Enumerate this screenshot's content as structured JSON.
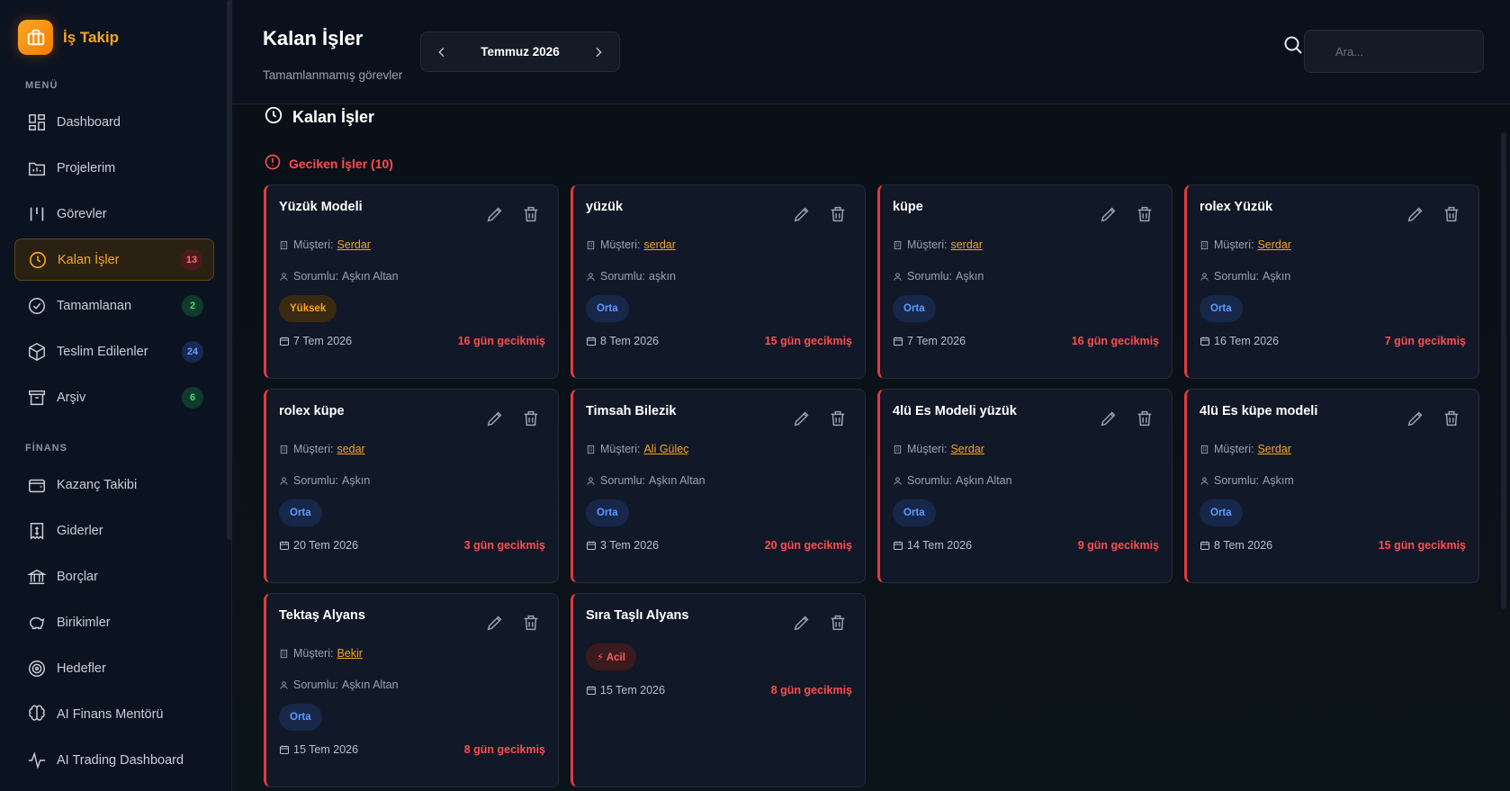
{
  "app": {
    "title": "İş Takip"
  },
  "sidebar": {
    "menu_label": "MENÜ",
    "finance_label": "FİNANS",
    "menu_items": [
      {
        "label": "Dashboard",
        "icon": "grid-icon",
        "badge": ""
      },
      {
        "label": "Projelerim",
        "icon": "folder-icon",
        "badge": ""
      },
      {
        "label": "Görevler",
        "icon": "columns-icon",
        "badge": ""
      },
      {
        "label": "Kalan İşler",
        "icon": "clock-icon",
        "badge": "13",
        "active": true
      },
      {
        "label": "Tamamlanan",
        "icon": "check-circle-icon",
        "badge": "2"
      },
      {
        "label": "Teslim Edilenler",
        "icon": "package-icon",
        "badge": "24"
      },
      {
        "label": "Arşiv",
        "icon": "archive-icon",
        "badge": "6"
      }
    ],
    "finance_items": [
      {
        "label": "Kazanç Takibi",
        "icon": "wallet-icon"
      },
      {
        "label": "Giderler",
        "icon": "receipt-icon"
      },
      {
        "label": "Borçlar",
        "icon": "bank-icon"
      },
      {
        "label": "Birikimler",
        "icon": "piggy-bank-icon"
      },
      {
        "label": "Hedefler",
        "icon": "target-icon"
      },
      {
        "label": "AI Finans Mentörü",
        "icon": "brain-icon"
      },
      {
        "label": "AI Trading Dashboard",
        "icon": "activity-icon"
      }
    ]
  },
  "header": {
    "title": "Kalan İşler",
    "subtitle": "Tamamlanmamış görevler",
    "month": "Temmuz 2026",
    "search_placeholder": "Ara..."
  },
  "main": {
    "section_title": "Kalan İşler",
    "overdue_title": "Geciken İşler (10)",
    "labels": {
      "customer": "Müşteri:",
      "owner": "Sorumlu:"
    },
    "cards": [
      {
        "title": "Yüzük Modeli",
        "customer": "Serdar",
        "owner": "Aşkın Altan",
        "priority": "Yüksek",
        "priority_type": "high",
        "date": "7 Tem 2026",
        "late": "16 gün gecikmiş"
      },
      {
        "title": "yüzük",
        "customer": "serdar",
        "owner": "aşkın",
        "priority": "Orta",
        "priority_type": "mid",
        "date": "8 Tem 2026",
        "late": "15 gün gecikmiş"
      },
      {
        "title": "küpe",
        "customer": "serdar",
        "owner": "Aşkın",
        "priority": "Orta",
        "priority_type": "mid",
        "date": "7 Tem 2026",
        "late": "16 gün gecikmiş"
      },
      {
        "title": "rolex Yüzük",
        "customer": "Serdar",
        "owner": "Aşkın",
        "priority": "Orta",
        "priority_type": "mid",
        "date": "16 Tem 2026",
        "late": "7 gün gecikmiş"
      },
      {
        "title": "rolex küpe",
        "customer": "sedar",
        "owner": "Aşkın",
        "priority": "Orta",
        "priority_type": "mid",
        "date": "20 Tem 2026",
        "late": "3 gün gecikmiş"
      },
      {
        "title": "Timsah Bilezik",
        "customer": "Ali Güleç",
        "owner": "Aşkın Altan",
        "priority": "Orta",
        "priority_type": "mid",
        "date": "3 Tem 2026",
        "late": "20 gün gecikmiş"
      },
      {
        "title": "4lü Es Modeli yüzük",
        "customer": "Serdar",
        "owner": "Aşkın Altan",
        "priority": "Orta",
        "priority_type": "mid",
        "date": "14 Tem 2026",
        "late": "9 gün gecikmiş"
      },
      {
        "title": "4lü Es küpe modeli",
        "customer": "Serdar",
        "owner": "Aşkım",
        "priority": "Orta",
        "priority_type": "mid",
        "date": "8 Tem 2026",
        "late": "15 gün gecikmiş"
      },
      {
        "title": "Tektaş Alyans",
        "customer": "Bekir",
        "owner": "Aşkın Altan",
        "priority": "Orta",
        "priority_type": "mid",
        "date": "15 Tem 2026",
        "late": "8 gün gecikmiş"
      },
      {
        "title": "Sıra Taşlı Alyans",
        "customer": "",
        "owner": "",
        "priority": "⚡ Acil",
        "priority_type": "urgent",
        "date": "15 Tem 2026",
        "late": "8 gün gecikmiş"
      }
    ]
  },
  "colors": {
    "accent": "#f5a524",
    "danger": "#ff4d4f",
    "mid": "#5b9bff",
    "bg": "#0a1018"
  }
}
